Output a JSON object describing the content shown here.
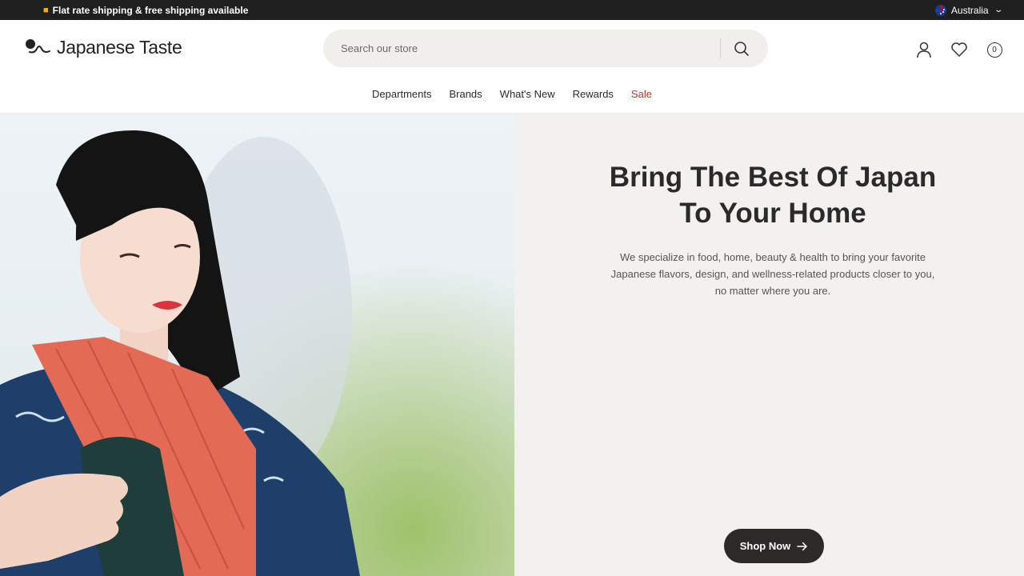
{
  "topbar": {
    "promo": "Flat rate shipping & free shipping available",
    "region": "Australia"
  },
  "header": {
    "logo_text": "Japanese Taste",
    "search_placeholder": "Search our store",
    "cart_count": "0"
  },
  "nav": {
    "items": [
      "Departments",
      "Brands",
      "What's New",
      "Rewards",
      "Sale"
    ]
  },
  "hero": {
    "headline_line1": "Bring The Best Of Japan",
    "headline_line2": "To Your Home",
    "sub_line1": "We specialize in food, home, beauty & health to bring your favorite",
    "sub_line2": "Japanese flavors, design, and wellness-related products closer to you,",
    "sub_line3": "no matter where you are.",
    "cta": "Shop Now"
  },
  "colors": {
    "topbar_bg": "#1f1f1f",
    "sale": "#c0312b",
    "hero_right_bg": "#f2f1ef",
    "cta_bg": "#2c2929"
  },
  "icons": [
    "truck-icon",
    "australia-flag-icon",
    "chevron-down-icon",
    "search-icon",
    "account-icon",
    "heart-icon",
    "cart-icon",
    "arrow-right-icon"
  ]
}
